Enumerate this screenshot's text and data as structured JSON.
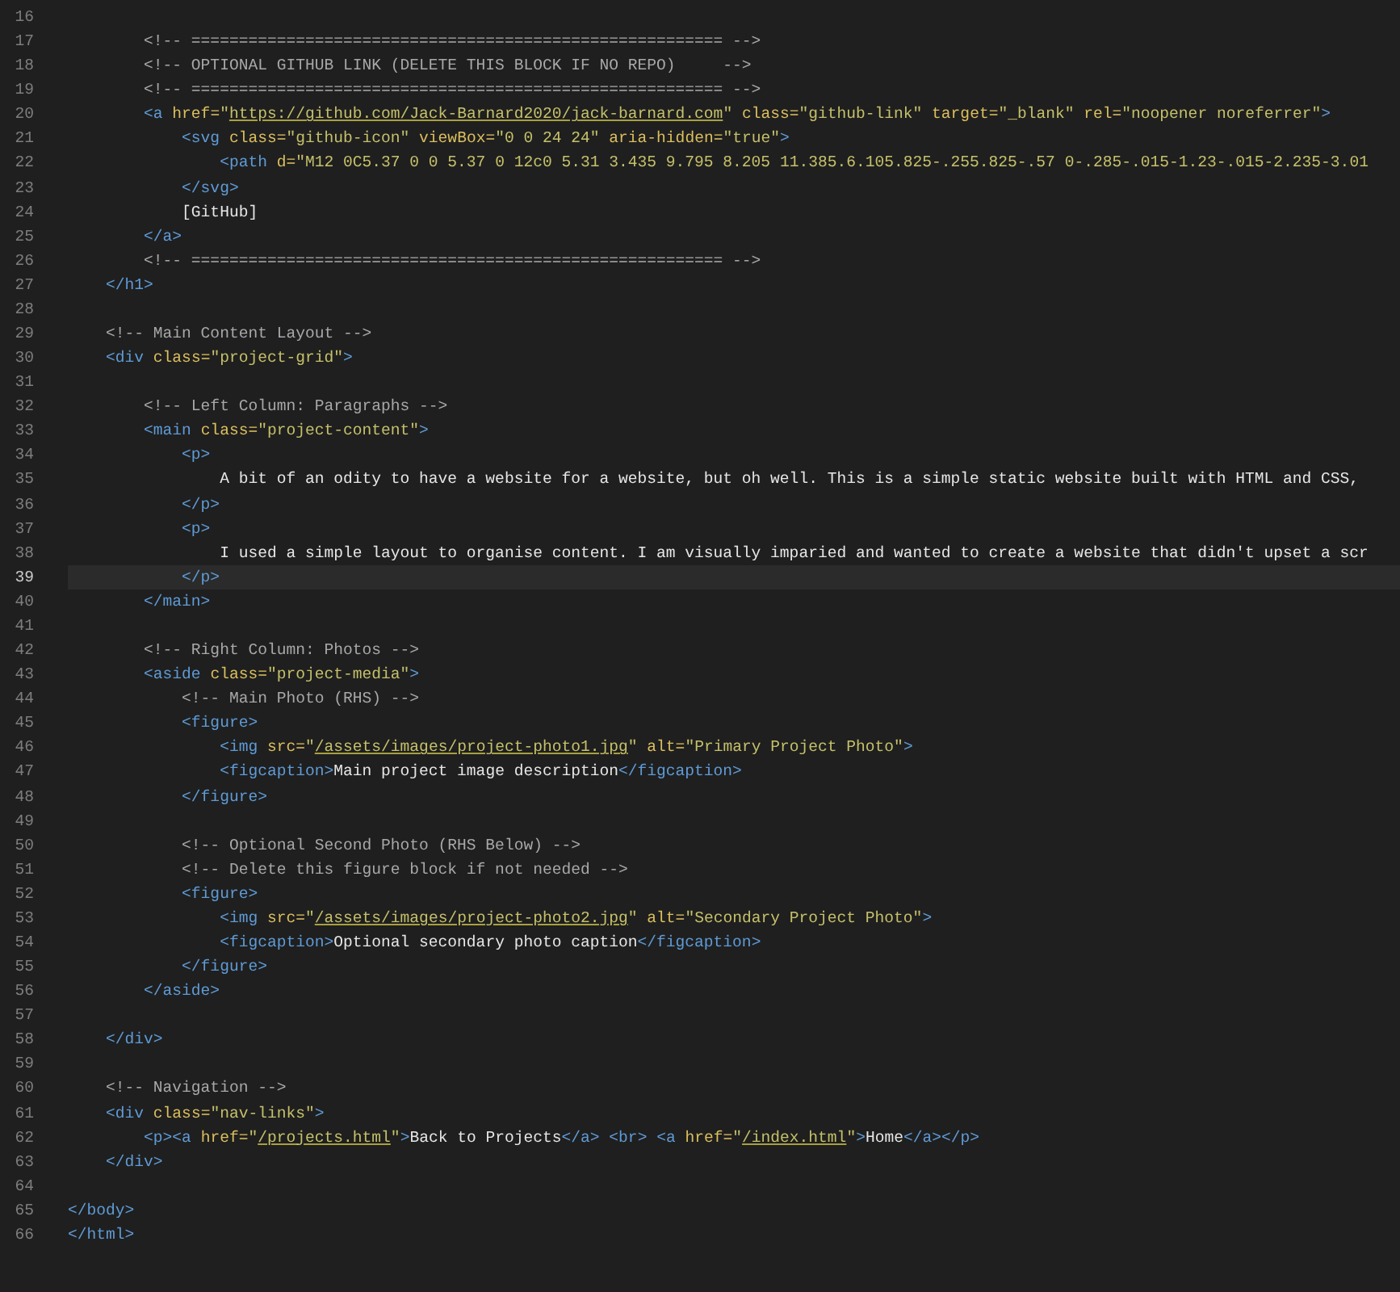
{
  "editor": {
    "lines": [
      {
        "number": "16",
        "current": false
      },
      {
        "number": "17",
        "current": false,
        "tokens": [
          {
            "kind": "comment",
            "text": "        <!-- ======================================================== -->"
          }
        ]
      },
      {
        "number": "18",
        "current": false,
        "tokens": [
          {
            "kind": "comment",
            "text": "        <!-- OPTIONAL GITHUB LINK (DELETE THIS BLOCK IF NO REPO)     -->"
          }
        ]
      },
      {
        "number": "19",
        "current": false,
        "tokens": [
          {
            "kind": "comment",
            "text": "        <!-- ======================================================== -->"
          }
        ]
      },
      {
        "number": "20",
        "current": false,
        "tokens": [
          {
            "kind": "tag",
            "text": "        <a "
          },
          {
            "kind": "attr",
            "text": "href="
          },
          {
            "kind": "string",
            "text": "\""
          },
          {
            "kind": "link",
            "text": "https://github.com/Jack-Barnard2020/jack-barnard.com"
          },
          {
            "kind": "string",
            "text": "\" "
          },
          {
            "kind": "attr",
            "text": "class="
          },
          {
            "kind": "string",
            "text": "\"github-link\" "
          },
          {
            "kind": "attr",
            "text": "target="
          },
          {
            "kind": "string",
            "text": "\"_blank\" "
          },
          {
            "kind": "attr",
            "text": "rel="
          },
          {
            "kind": "string",
            "text": "\"noopener noreferrer\""
          },
          {
            "kind": "tag",
            "text": ">"
          }
        ]
      },
      {
        "number": "21",
        "current": false,
        "tokens": [
          {
            "kind": "tag",
            "text": "            <svg "
          },
          {
            "kind": "attr",
            "text": "class="
          },
          {
            "kind": "string",
            "text": "\"github-icon\" "
          },
          {
            "kind": "attr",
            "text": "viewBox="
          },
          {
            "kind": "string",
            "text": "\"0 0 24 24\" "
          },
          {
            "kind": "attr",
            "text": "aria-hidden="
          },
          {
            "kind": "string",
            "text": "\"true\""
          },
          {
            "kind": "tag",
            "text": ">"
          }
        ]
      },
      {
        "number": "22",
        "current": false,
        "tokens": [
          {
            "kind": "tag",
            "text": "                <path "
          },
          {
            "kind": "attr",
            "text": "d="
          },
          {
            "kind": "string",
            "text": "\"M12 0C5.37 0 0 5.37 0 12c0 5.31 3.435 9.795 8.205 11.385.6.105.825-.255.825-.57 0-.285-.015-1.23-.015-2.235-3.01"
          }
        ]
      },
      {
        "number": "23",
        "current": false,
        "tokens": [
          {
            "kind": "tag",
            "text": "            </svg>"
          }
        ]
      },
      {
        "number": "24",
        "current": false,
        "tokens": [
          {
            "kind": "text",
            "text": "            [GitHub]"
          }
        ]
      },
      {
        "number": "25",
        "current": false,
        "tokens": [
          {
            "kind": "tag",
            "text": "        </a>"
          }
        ]
      },
      {
        "number": "26",
        "current": false,
        "tokens": [
          {
            "kind": "comment",
            "text": "        <!-- ======================================================== -->"
          }
        ]
      },
      {
        "number": "27",
        "current": false,
        "tokens": [
          {
            "kind": "tag",
            "text": "    </h1>"
          }
        ]
      },
      {
        "number": "28",
        "current": false
      },
      {
        "number": "29",
        "current": false,
        "tokens": [
          {
            "kind": "comment",
            "text": "    <!-- Main Content Layout -->"
          }
        ]
      },
      {
        "number": "30",
        "current": false,
        "tokens": [
          {
            "kind": "tag",
            "text": "    <div "
          },
          {
            "kind": "attr",
            "text": "class="
          },
          {
            "kind": "string",
            "text": "\"project-grid\""
          },
          {
            "kind": "tag",
            "text": ">"
          }
        ]
      },
      {
        "number": "31",
        "current": false
      },
      {
        "number": "32",
        "current": false,
        "tokens": [
          {
            "kind": "comment",
            "text": "        <!-- Left Column: Paragraphs -->"
          }
        ]
      },
      {
        "number": "33",
        "current": false,
        "tokens": [
          {
            "kind": "tag",
            "text": "        <main "
          },
          {
            "kind": "attr",
            "text": "class="
          },
          {
            "kind": "string",
            "text": "\"project-content\""
          },
          {
            "kind": "tag",
            "text": ">"
          }
        ]
      },
      {
        "number": "34",
        "current": false,
        "tokens": [
          {
            "kind": "tag",
            "text": "            <p>"
          }
        ]
      },
      {
        "number": "35",
        "current": false,
        "tokens": [
          {
            "kind": "text",
            "text": "                A bit of an odity to have a website for a website, but oh well. This is a simple static website built with HTML and CSS,"
          }
        ]
      },
      {
        "number": "36",
        "current": false,
        "tokens": [
          {
            "kind": "tag",
            "text": "            </p>"
          }
        ]
      },
      {
        "number": "37",
        "current": false,
        "tokens": [
          {
            "kind": "tag",
            "text": "            <p>"
          }
        ]
      },
      {
        "number": "38",
        "current": false,
        "tokens": [
          {
            "kind": "text",
            "text": "                I used a simple layout to organise content. I am visually imparied and wanted to create a website that didn't upset a scr"
          }
        ]
      },
      {
        "number": "39",
        "current": true,
        "tokens": [
          {
            "kind": "tag",
            "text": "            </p>"
          }
        ]
      },
      {
        "number": "40",
        "current": false,
        "tokens": [
          {
            "kind": "tag",
            "text": "        </main>"
          }
        ]
      },
      {
        "number": "41",
        "current": false
      },
      {
        "number": "42",
        "current": false,
        "tokens": [
          {
            "kind": "comment",
            "text": "        <!-- Right Column: Photos -->"
          }
        ]
      },
      {
        "number": "43",
        "current": false,
        "tokens": [
          {
            "kind": "tag",
            "text": "        <aside "
          },
          {
            "kind": "attr",
            "text": "class="
          },
          {
            "kind": "string",
            "text": "\"project-media\""
          },
          {
            "kind": "tag",
            "text": ">"
          }
        ]
      },
      {
        "number": "44",
        "current": false,
        "tokens": [
          {
            "kind": "comment",
            "text": "            <!-- Main Photo (RHS) -->"
          }
        ]
      },
      {
        "number": "45",
        "current": false,
        "tokens": [
          {
            "kind": "tag",
            "text": "            <figure>"
          }
        ]
      },
      {
        "number": "46",
        "current": false,
        "tokens": [
          {
            "kind": "tag",
            "text": "                <img "
          },
          {
            "kind": "attr",
            "text": "src="
          },
          {
            "kind": "string",
            "text": "\""
          },
          {
            "kind": "link",
            "text": "/assets/images/project-photo1.jpg"
          },
          {
            "kind": "string",
            "text": "\" "
          },
          {
            "kind": "attr",
            "text": "alt="
          },
          {
            "kind": "string",
            "text": "\"Primary Project Photo\""
          },
          {
            "kind": "tag",
            "text": ">"
          }
        ]
      },
      {
        "number": "47",
        "current": false,
        "tokens": [
          {
            "kind": "tag",
            "text": "                <figcaption>"
          },
          {
            "kind": "text",
            "text": "Main project image description"
          },
          {
            "kind": "tag",
            "text": "</figcaption>"
          }
        ]
      },
      {
        "number": "48",
        "current": false,
        "tokens": [
          {
            "kind": "tag",
            "text": "            </figure>"
          }
        ]
      },
      {
        "number": "49",
        "current": false
      },
      {
        "number": "50",
        "current": false,
        "tokens": [
          {
            "kind": "comment",
            "text": "            <!-- Optional Second Photo (RHS Below) -->"
          }
        ]
      },
      {
        "number": "51",
        "current": false,
        "tokens": [
          {
            "kind": "comment",
            "text": "            <!-- Delete this figure block if not needed -->"
          }
        ]
      },
      {
        "number": "52",
        "current": false,
        "tokens": [
          {
            "kind": "tag",
            "text": "            <figure>"
          }
        ]
      },
      {
        "number": "53",
        "current": false,
        "tokens": [
          {
            "kind": "tag",
            "text": "                <img "
          },
          {
            "kind": "attr",
            "text": "src="
          },
          {
            "kind": "string",
            "text": "\""
          },
          {
            "kind": "link",
            "text": "/assets/images/project-photo2.jpg"
          },
          {
            "kind": "string",
            "text": "\" "
          },
          {
            "kind": "attr",
            "text": "alt="
          },
          {
            "kind": "string",
            "text": "\"Secondary Project Photo\""
          },
          {
            "kind": "tag",
            "text": ">"
          }
        ]
      },
      {
        "number": "54",
        "current": false,
        "tokens": [
          {
            "kind": "tag",
            "text": "                <figcaption>"
          },
          {
            "kind": "text",
            "text": "Optional secondary photo caption"
          },
          {
            "kind": "tag",
            "text": "</figcaption>"
          }
        ]
      },
      {
        "number": "55",
        "current": false,
        "tokens": [
          {
            "kind": "tag",
            "text": "            </figure>"
          }
        ]
      },
      {
        "number": "56",
        "current": false,
        "tokens": [
          {
            "kind": "tag",
            "text": "        </aside>"
          }
        ]
      },
      {
        "number": "57",
        "current": false
      },
      {
        "number": "58",
        "current": false,
        "tokens": [
          {
            "kind": "tag",
            "text": "    </div>"
          }
        ]
      },
      {
        "number": "59",
        "current": false
      },
      {
        "number": "60",
        "current": false,
        "tokens": [
          {
            "kind": "comment",
            "text": "    <!-- Navigation -->"
          }
        ]
      },
      {
        "number": "61",
        "current": false,
        "tokens": [
          {
            "kind": "tag",
            "text": "    <div "
          },
          {
            "kind": "attr",
            "text": "class="
          },
          {
            "kind": "string",
            "text": "\"nav-links\""
          },
          {
            "kind": "tag",
            "text": ">"
          }
        ]
      },
      {
        "number": "62",
        "current": false,
        "tokens": [
          {
            "kind": "tag",
            "text": "        <p><a "
          },
          {
            "kind": "attr",
            "text": "href="
          },
          {
            "kind": "string",
            "text": "\""
          },
          {
            "kind": "link",
            "text": "/projects.html"
          },
          {
            "kind": "string",
            "text": "\""
          },
          {
            "kind": "tag",
            "text": ">"
          },
          {
            "kind": "text",
            "text": "Back to Projects"
          },
          {
            "kind": "tag",
            "text": "</a> <br> <a "
          },
          {
            "kind": "attr",
            "text": "href="
          },
          {
            "kind": "string",
            "text": "\""
          },
          {
            "kind": "link",
            "text": "/index.html"
          },
          {
            "kind": "string",
            "text": "\""
          },
          {
            "kind": "tag",
            "text": ">"
          },
          {
            "kind": "text",
            "text": "Home"
          },
          {
            "kind": "tag",
            "text": "</a></p>"
          }
        ]
      },
      {
        "number": "63",
        "current": false,
        "tokens": [
          {
            "kind": "tag",
            "text": "    </div>"
          }
        ]
      },
      {
        "number": "64",
        "current": false
      },
      {
        "number": "65",
        "current": false,
        "tokens": [
          {
            "kind": "tag",
            "text": "</body>"
          }
        ]
      },
      {
        "number": "66",
        "current": false,
        "tokens": [
          {
            "kind": "tag",
            "text": "</html>"
          }
        ]
      }
    ]
  }
}
